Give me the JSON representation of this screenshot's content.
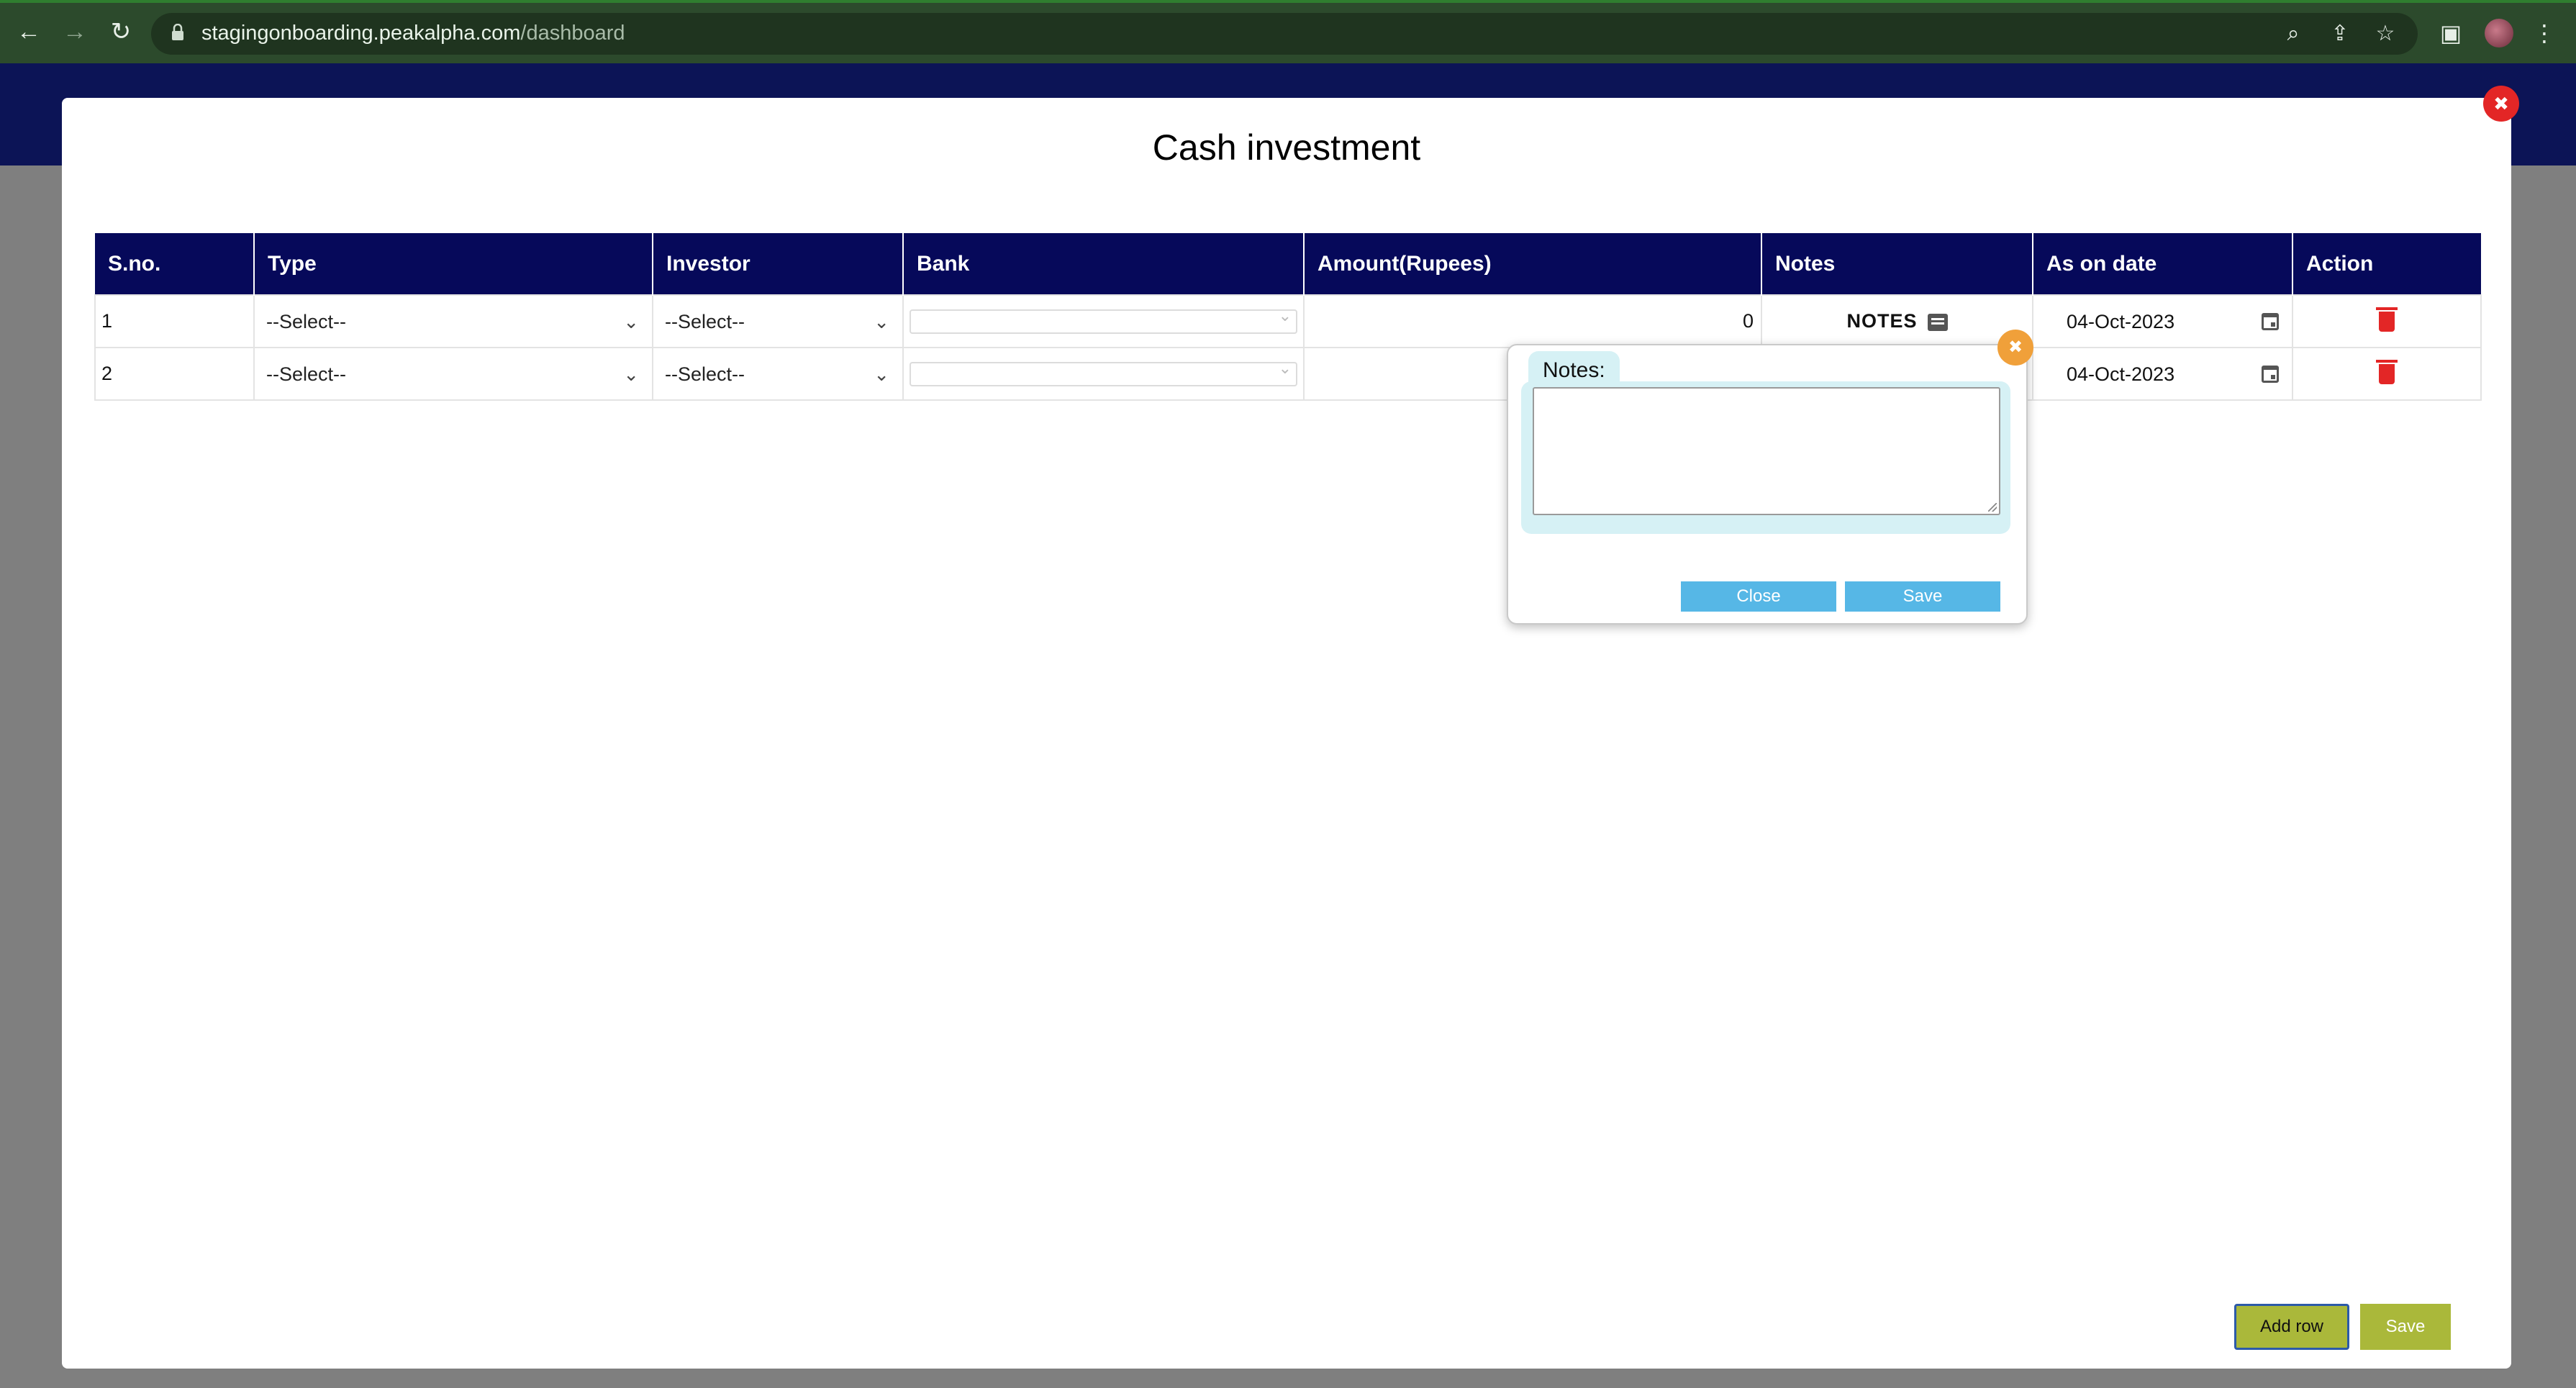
{
  "browser": {
    "url_domain": "stagingonboarding.peakalpha.com",
    "url_path": "/dashboard"
  },
  "modal": {
    "title": "Cash investment",
    "columns": [
      "S.no.",
      "Type",
      "Investor",
      "Bank",
      "Amount(Rupees)",
      "Notes",
      "As on date",
      "Action"
    ],
    "rows": [
      {
        "sno": "1",
        "type": "--Select--",
        "investor": "--Select--",
        "bank": "",
        "amount": "0",
        "notes": "NOTES",
        "date": "04-Oct-2023"
      },
      {
        "sno": "2",
        "type": "--Select--",
        "investor": "--Select--",
        "bank": "",
        "amount": "",
        "notes": "",
        "date": "04-Oct-2023"
      }
    ],
    "add_row_label": "Add row",
    "save_label": "Save"
  },
  "notes_popover": {
    "label": "Notes:",
    "value": "",
    "close_label": "Close",
    "save_label": "Save"
  },
  "colors": {
    "table_header": "#06095a",
    "accent_button": "#aab83a",
    "popover_button": "#56b7e6",
    "delete_red": "#e32626",
    "popover_close": "#f0a03a"
  }
}
